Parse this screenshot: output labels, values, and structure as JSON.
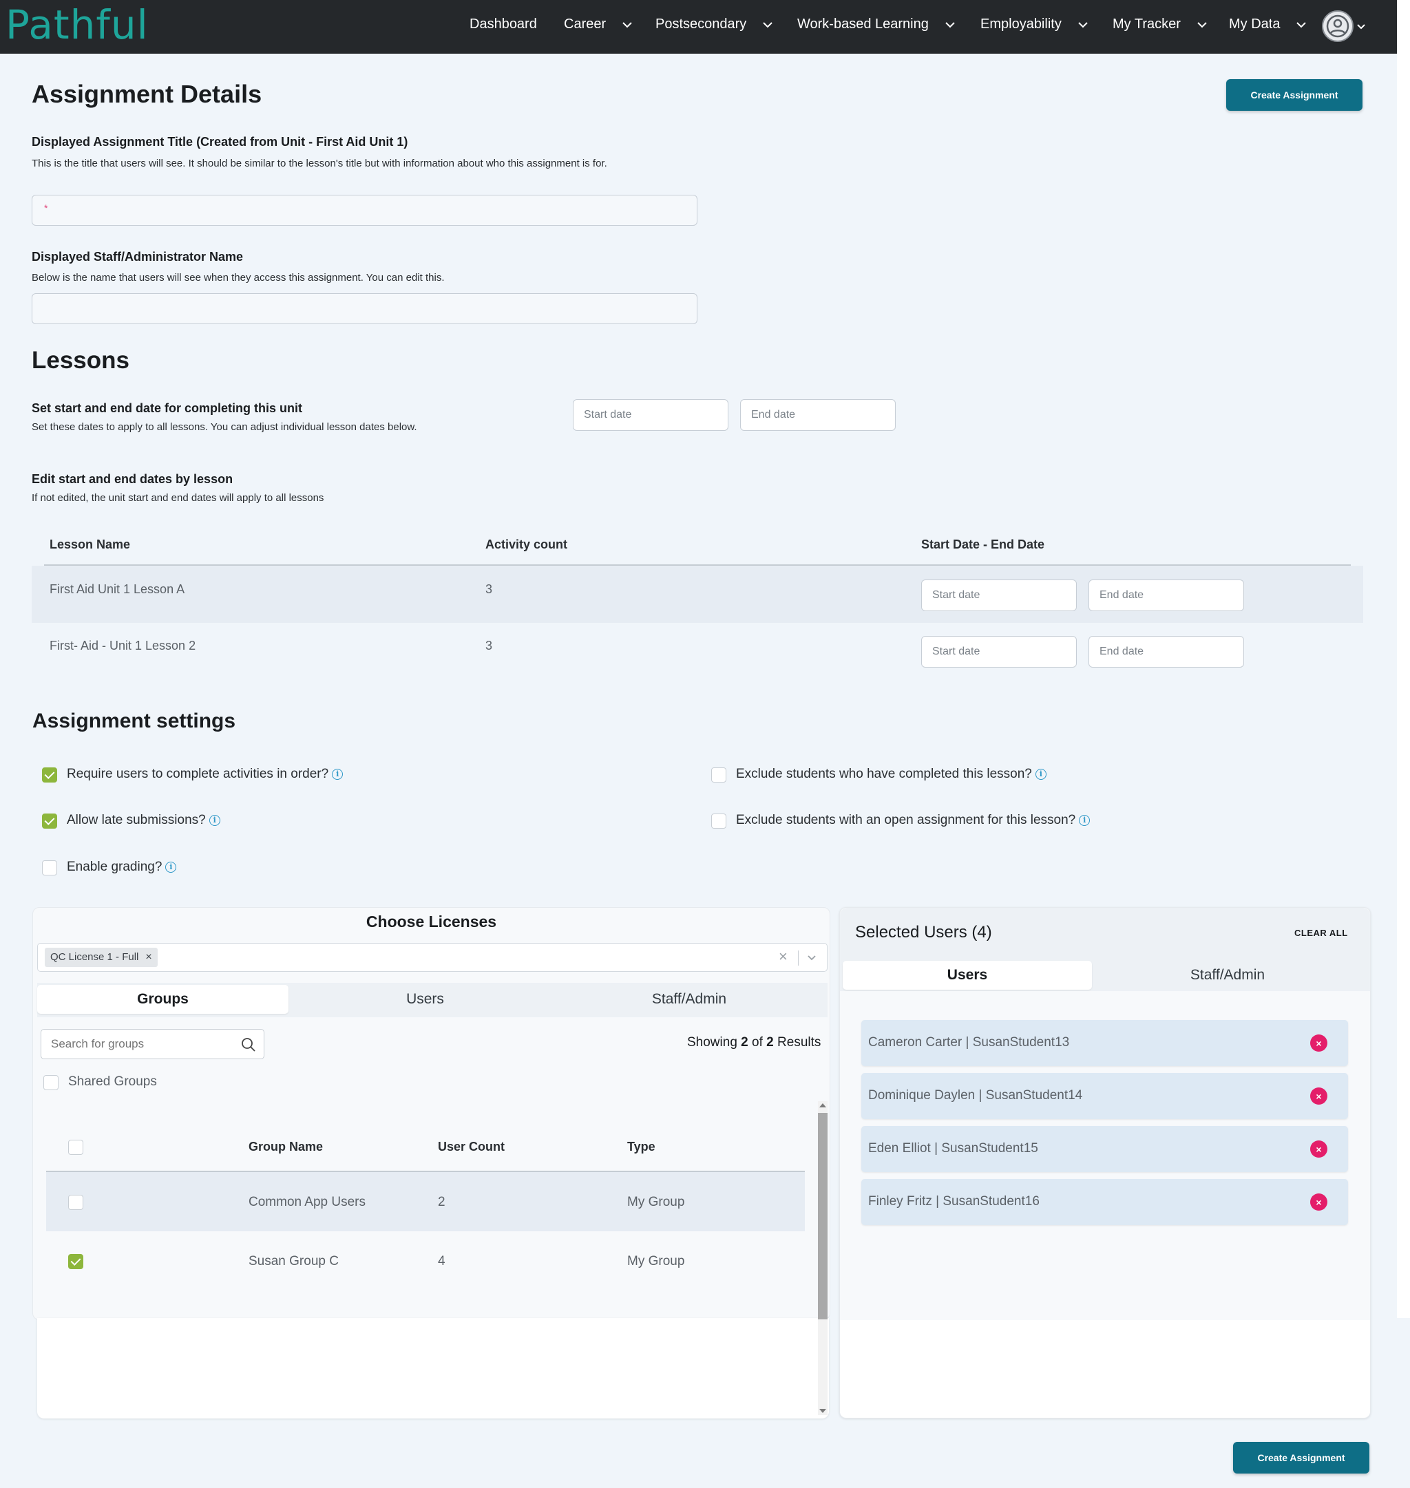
{
  "nav": {
    "logo": "Pathful",
    "items": [
      "Dashboard",
      "Career",
      "Postsecondary",
      "Work-based Learning",
      "Employability",
      "My Tracker",
      "My Data"
    ]
  },
  "header": {
    "title": "Assignment Details",
    "create_button": "Create Assignment"
  },
  "assignment_title": {
    "label": "Displayed Assignment Title (Created from Unit - First Aid Unit 1)",
    "helper": "This is the title that users will see. It should be similar to the lesson's title but with information about who this assignment is for.",
    "required_mark": "*",
    "value": ""
  },
  "staff_name": {
    "label": "Displayed Staff/Administrator Name",
    "helper": "Below is the name that users will see when they access this assignment. You can edit this.",
    "value": ""
  },
  "lessons": {
    "title": "Lessons",
    "unit_dates_label": "Set start and end date for completing this unit",
    "unit_dates_helper": "Set these dates to apply to all lessons. You can adjust individual lesson dates below.",
    "start_placeholder": "Start date",
    "end_placeholder": "End date",
    "edit_label": "Edit start and end dates by lesson",
    "edit_helper": "If not edited, the unit start and end dates will apply to all lessons",
    "columns": [
      "Lesson Name",
      "Activity count",
      "Start Date - End Date"
    ],
    "rows": [
      {
        "name": "First Aid Unit 1 Lesson A",
        "count": "3"
      },
      {
        "name": "First- Aid - Unit 1 Lesson 2",
        "count": "3"
      }
    ]
  },
  "settings": {
    "title": "Assignment settings",
    "options": [
      {
        "label": "Require users to complete activities in order?",
        "checked": true
      },
      {
        "label": "Allow late submissions?",
        "checked": true
      },
      {
        "label": "Enable grading?",
        "checked": false
      },
      {
        "label": "Exclude students who have completed this lesson?",
        "checked": false
      },
      {
        "label": "Exclude students with an open assignment for this lesson?",
        "checked": false
      }
    ],
    "info_glyph": "i"
  },
  "licenses": {
    "title": "Choose Licenses",
    "selected_chip": "QC License 1 - Full",
    "chip_remove": "×",
    "clear_glyph": "×",
    "tabs": [
      "Groups",
      "Users",
      "Staff/Admin"
    ],
    "search_placeholder": "Search for groups",
    "showing_prefix": "Showing",
    "showing_count": "2",
    "showing_of": "of",
    "showing_total": "2",
    "showing_suffix": "Results",
    "shared_groups_label": "Shared Groups",
    "columns": [
      "Group Name",
      "User Count",
      "Type"
    ],
    "rows": [
      {
        "name": "Common App Users",
        "count": "2",
        "type": "My Group",
        "checked": false
      },
      {
        "name": "Susan Group C",
        "count": "4",
        "type": "My Group",
        "checked": true
      }
    ]
  },
  "selected_users": {
    "title": "Selected Users (4)",
    "clear_all": "CLEAR ALL",
    "tabs": [
      "Users",
      "Staff/Admin"
    ],
    "remove_glyph": "×",
    "users": [
      "Cameron Carter | SusanStudent13",
      "Dominique Daylen | SusanStudent14",
      "Eden Elliot | SusanStudent15",
      "Finley Fritz | SusanStudent16"
    ]
  },
  "colors": {
    "nav_bg": "#25282b",
    "brand_teal": "#1ea59a",
    "primary_button": "#0e6e86",
    "checkbox_on": "#8db63c",
    "remove_pink": "#e41e6a",
    "info_blue": "#2d97c7"
  }
}
